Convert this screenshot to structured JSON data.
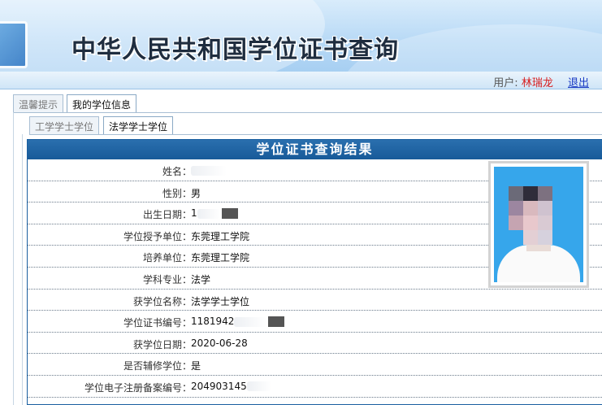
{
  "banner": {
    "title": "中华人民共和国学位证书查询"
  },
  "user": {
    "label": "用户:",
    "name": "林瑞龙",
    "logout": "退出"
  },
  "tabs_primary": [
    {
      "label": "温馨提示",
      "active": false
    },
    {
      "label": "我的学位信息",
      "active": true
    }
  ],
  "tabs_secondary": [
    {
      "label": "工学学士学位",
      "active": false
    },
    {
      "label": "法学学士学位",
      "active": true
    }
  ],
  "result": {
    "title": "学位证书查询结果",
    "fields": [
      {
        "label": "姓名：",
        "value": ""
      },
      {
        "label": "性别：",
        "value": "男"
      },
      {
        "label": "出生日期：",
        "value": "1"
      },
      {
        "label": "学位授予单位：",
        "value": "东莞理工学院"
      },
      {
        "label": "培养单位：",
        "value": "东莞理工学院"
      },
      {
        "label": "学科专业：",
        "value": "法学"
      },
      {
        "label": "获学位名称：",
        "value": "法学学士学位"
      },
      {
        "label": "学位证书编号：",
        "value": "1181942"
      },
      {
        "label": "获学位日期：",
        "value": "2020-06-28"
      },
      {
        "label": "是否辅修学位：",
        "value": "是"
      },
      {
        "label": "学位电子注册备案编号：",
        "value": "204903145"
      }
    ]
  },
  "colors": {
    "banner_bg": "#b9daf6",
    "panel_header": "#175a99",
    "user_name": "#d81e1e",
    "logout_link": "#1a3bc4",
    "photo_bg": "#36a6eb"
  }
}
